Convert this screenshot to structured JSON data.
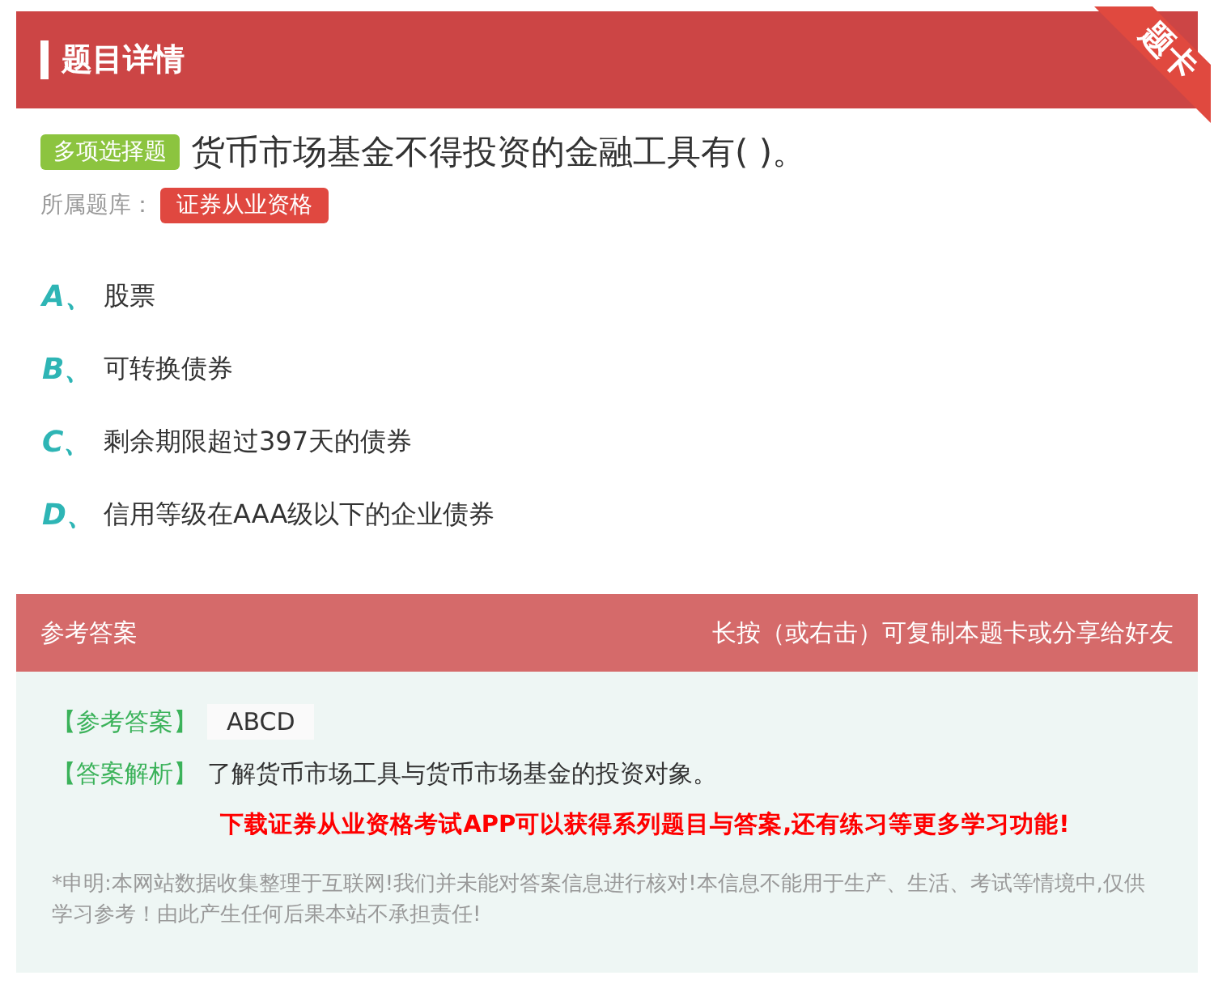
{
  "header": {
    "title": "题目详情",
    "ribbon": "题卡"
  },
  "question": {
    "type_tag": "多项选择题",
    "text": "货币市场基金不得投资的金融工具有( )。",
    "bank_label": "所属题库：",
    "bank_tag": "证券从业资格"
  },
  "options": [
    {
      "letter": "A、",
      "text": "股票"
    },
    {
      "letter": "B、",
      "text": "可转换债券"
    },
    {
      "letter": "C、",
      "text": "剩余期限超过397天的债券"
    },
    {
      "letter": "D、",
      "text": "信用等级在AAA级以下的企业债券"
    }
  ],
  "answer_bar": {
    "title": "参考答案",
    "hint": "长按（或右击）可复制本题卡或分享给好友"
  },
  "answer": {
    "answer_label": "【参考答案】",
    "answer_value": "ABCD",
    "analysis_label": "【答案解析】",
    "analysis_text": "了解货币市场工具与货币市场基金的投资对象。",
    "promo": "下载证券从业资格考试APP可以获得系列题目与答案,还有练习等更多学习功能!",
    "disclaimer": "*申明:本网站数据收集整理于互联网!我们并未能对答案信息进行核对!本信息不能用于生产、生活、考试等情境中,仅供学习参考！由此产生任何后果本站不承担责任!"
  }
}
